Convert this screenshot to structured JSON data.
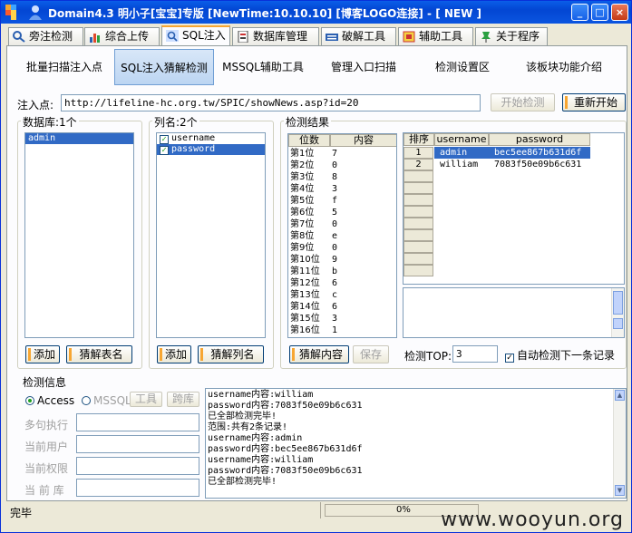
{
  "window": {
    "title": "Domain4.3 明小子[宝宝]专版 [NewTime:10.10.10] [博客LOGO连接]  - [ NEW ]",
    "buttons": {
      "minimize": "_",
      "maximize": "□",
      "close": "×"
    }
  },
  "tabs": [
    {
      "label": "旁注检测",
      "icon": "magnifier-icon"
    },
    {
      "label": "综合上传",
      "icon": "chart-icon"
    },
    {
      "label": "SQL注入",
      "icon": "search-icon"
    },
    {
      "label": "数据库管理",
      "icon": "database-icon"
    },
    {
      "label": "破解工具",
      "icon": "keyboard-icon"
    },
    {
      "label": "辅助工具",
      "icon": "tool-icon"
    },
    {
      "label": "关于程序",
      "icon": "pin-icon"
    }
  ],
  "subtabs": [
    "批量扫描注入点",
    "SQL注入猜解检测",
    "MSSQL辅助工具",
    "管理入口扫描",
    "检测设置区",
    "该板块功能介绍"
  ],
  "inject": {
    "label": "注入点:",
    "url": "http://lifeline-hc.org.tw/SPIC/showNews.asp?id=20",
    "start_btn": "开始检测",
    "restart_btn": "重新开始"
  },
  "database": {
    "label": "数据库:1个",
    "items": [
      "admin"
    ],
    "add_btn": "添加",
    "guess_btn": "猜解表名"
  },
  "columns": {
    "label": "列名:2个",
    "items": [
      "username",
      "password"
    ],
    "add_btn": "添加",
    "guess_btn": "猜解列名"
  },
  "results": {
    "label": "检测结果",
    "pos_headers": [
      "位数",
      "内容"
    ],
    "pos_rows": [
      [
        "第1位",
        "7"
      ],
      [
        "第2位",
        "0"
      ],
      [
        "第3位",
        "8"
      ],
      [
        "第4位",
        "3"
      ],
      [
        "第5位",
        "f"
      ],
      [
        "第6位",
        "5"
      ],
      [
        "第7位",
        "0"
      ],
      [
        "第8位",
        "e"
      ],
      [
        "第9位",
        "0"
      ],
      [
        "第10位",
        "9"
      ],
      [
        "第11位",
        "b"
      ],
      [
        "第12位",
        "6"
      ],
      [
        "第13位",
        "c"
      ],
      [
        "第14位",
        "6"
      ],
      [
        "第15位",
        "3"
      ],
      [
        "第16位",
        "1"
      ]
    ],
    "rec_headers": [
      "排序",
      "username",
      "password"
    ],
    "rec_rows": [
      [
        "1",
        "admin",
        "bec5ee867b631d6f"
      ],
      [
        "2",
        "william",
        "7083f50e09b6c631"
      ]
    ],
    "guess_btn": "猜解内容",
    "save_btn": "保存",
    "top_label": "检测TOP:",
    "top_value": "3",
    "auto_label": "自动检测下一条记录"
  },
  "detect_info": {
    "label": "检测信息",
    "access": "Access",
    "mssql": "MSSQL",
    "tool_btn": "工具",
    "crossdb_btn": "跨库",
    "fields": [
      "多句执行",
      "当前用户",
      "当前权限",
      "当 前 库"
    ],
    "log": [
      "username内容:william",
      "password内容:7083f50e09b6c631",
      "已全部检测完毕!",
      "范围:共有2条记录!",
      "username内容:admin",
      "password内容:bec5ee867b631d6f",
      "username内容:william",
      "password内容:7083f50e09b6c631",
      "已全部检测完毕!"
    ]
  },
  "status": {
    "text": "完毕",
    "progress": "0%",
    "progress_value": 0,
    "watermark": "www.wooyun.org"
  },
  "colors": {
    "accent": "#f7a632",
    "selection": "#316ac5",
    "titlebar": "#0346d3"
  }
}
